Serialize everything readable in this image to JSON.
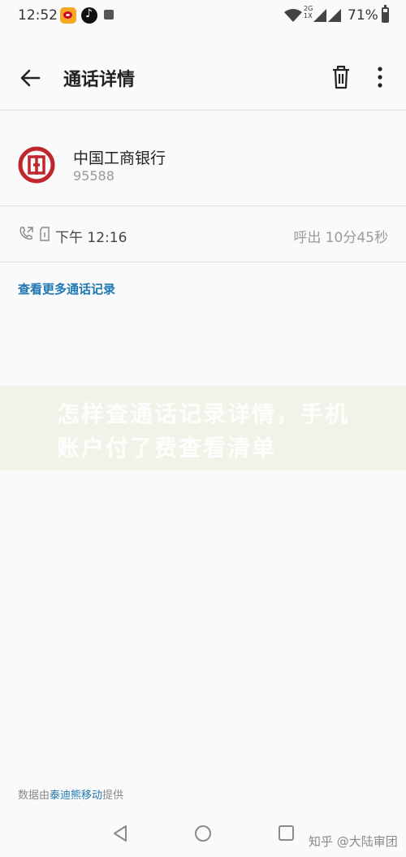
{
  "status_bar": {
    "time": "12:52",
    "network": "2G",
    "network_sub": "1X",
    "battery_text": "71%",
    "battery_level": 0.71,
    "icons": [
      "weibo-icon",
      "tiktok-icon",
      "lock-icon",
      "wifi-icon",
      "signal-icon",
      "battery-icon"
    ]
  },
  "toolbar": {
    "title": "通话详情",
    "icons": [
      "back-arrow-icon",
      "trash-icon",
      "more-vertical-icon"
    ]
  },
  "contact": {
    "name": "中国工商银行",
    "number": "95588",
    "logo_color": "#c0272d"
  },
  "call": {
    "time": "下午 12:16",
    "meta": "呼出 10分45秒"
  },
  "more_link": "查看更多通话记录",
  "watermark": "怎样查通话记录详情，手机账户付了费查看清单",
  "footer": {
    "prefix": "数据由",
    "provider": "泰迪熊移动",
    "suffix": "提供"
  },
  "nav": {
    "icons": [
      "nav-back-icon",
      "nav-home-icon",
      "nav-recent-icon"
    ]
  },
  "zhihu_watermark": "知乎 @大陆审团",
  "colors": {
    "accent": "#1e78b4",
    "background": "#fafafa",
    "divider": "#dedede",
    "secondary_text": "#9a9a9a"
  }
}
